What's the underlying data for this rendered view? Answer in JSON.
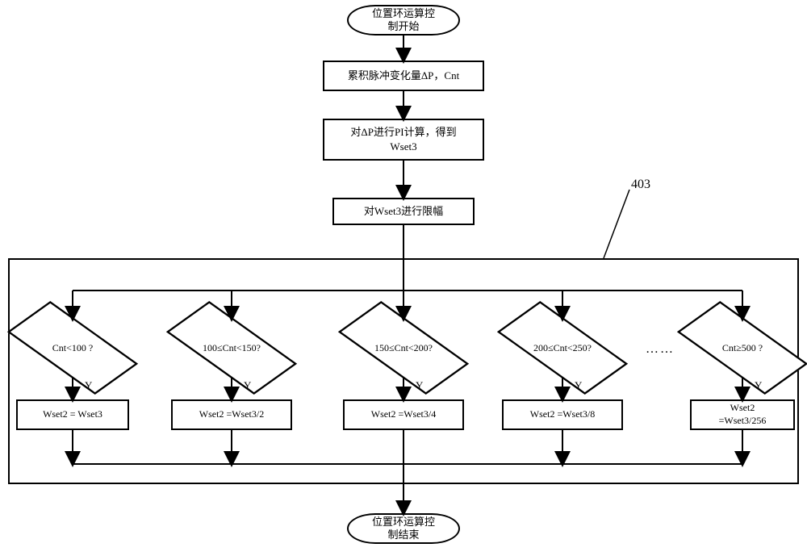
{
  "start": "位置环运算控\n制开始",
  "step1": "累积脉冲变化量ΔP，Cnt",
  "step2": "对ΔP进行PI计算，得到\nWset3",
  "step3": "对Wset3进行限幅",
  "frame_ref": "403",
  "decisions": [
    {
      "cond": "Cnt<100 ?",
      "yes": "Y",
      "action": "Wset2 = Wset3"
    },
    {
      "cond": "100≤Cnt<150?",
      "yes": "Y",
      "action": "Wset2 =Wset3/2"
    },
    {
      "cond": "150≤Cnt<200?",
      "yes": "Y",
      "action": "Wset2 =Wset3/4"
    },
    {
      "cond": "200≤Cnt<250?",
      "yes": "Y",
      "action": "Wset2 =Wset3/8"
    },
    {
      "cond": "Cnt≥500 ?",
      "yes": "Y",
      "action": "Wset2\n=Wset3/256"
    }
  ],
  "ellipsis": "……",
  "end": "位置环运算控\n制结束"
}
